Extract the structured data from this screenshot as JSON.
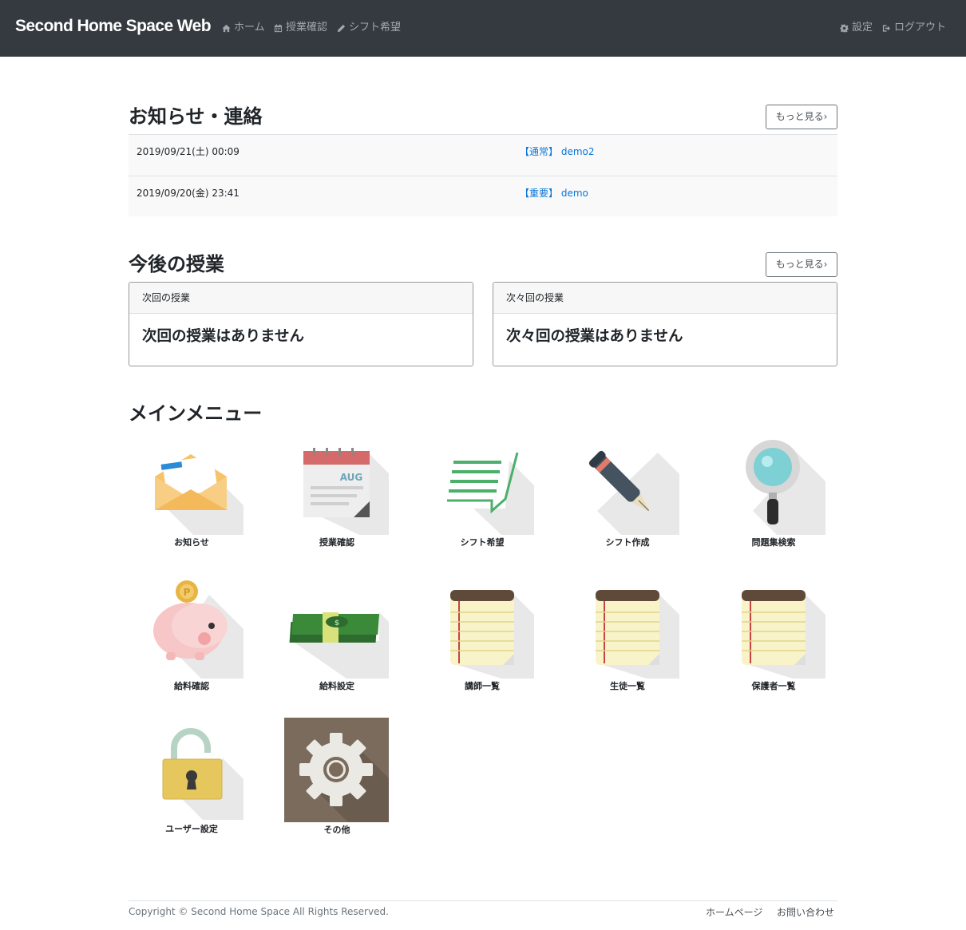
{
  "navbar": {
    "brand": "Second Home Space Web",
    "left_items": [
      {
        "label": "ホーム",
        "icon": "home-icon"
      },
      {
        "label": "授業確認",
        "icon": "calendar-icon"
      },
      {
        "label": "シフト希望",
        "icon": "pencil-icon"
      }
    ],
    "right_items": [
      {
        "label": "設定",
        "icon": "gear-icon"
      },
      {
        "label": "ログアウト",
        "icon": "sign-out-icon"
      }
    ]
  },
  "notices": {
    "title": "お知らせ・連絡",
    "more_label": "もっと見る›",
    "items": [
      {
        "date": "2019/09/21(土) 00:09",
        "tag": "【通常】",
        "name": "demo2"
      },
      {
        "date": "2019/09/20(金) 23:41",
        "tag": "【重要】",
        "name": "demo"
      }
    ]
  },
  "lessons": {
    "title": "今後の授業",
    "more_label": "もっと見る›",
    "cards": [
      {
        "header": "次回の授業",
        "body": "次回の授業はありません"
      },
      {
        "header": "次々回の授業",
        "body": "次々回の授業はありません"
      }
    ]
  },
  "menu": {
    "title": "メインメニュー",
    "items": [
      {
        "label": "お知らせ",
        "icon": "envelope-icon"
      },
      {
        "label": "授業確認",
        "icon": "calendar-icon"
      },
      {
        "label": "シフト希望",
        "icon": "message-icon"
      },
      {
        "label": "シフト作成",
        "icon": "fountain-pen-icon"
      },
      {
        "label": "問題集検索",
        "icon": "magnifier-icon"
      },
      {
        "label": "給料確認",
        "icon": "piggy-bank-icon"
      },
      {
        "label": "給料設定",
        "icon": "money-stack-icon"
      },
      {
        "label": "講師一覧",
        "icon": "notepad-icon"
      },
      {
        "label": "生徒一覧",
        "icon": "notepad-icon"
      },
      {
        "label": "保護者一覧",
        "icon": "notepad-icon"
      },
      {
        "label": "ユーザー設定",
        "icon": "padlock-icon"
      },
      {
        "label": "その他",
        "icon": "gear-icon"
      }
    ],
    "calendar_month": "AUG"
  },
  "footer": {
    "copyright": "Copyright © Second Home Space All Rights Reserved.",
    "links": [
      "ホームページ",
      "お問い合わせ"
    ]
  }
}
